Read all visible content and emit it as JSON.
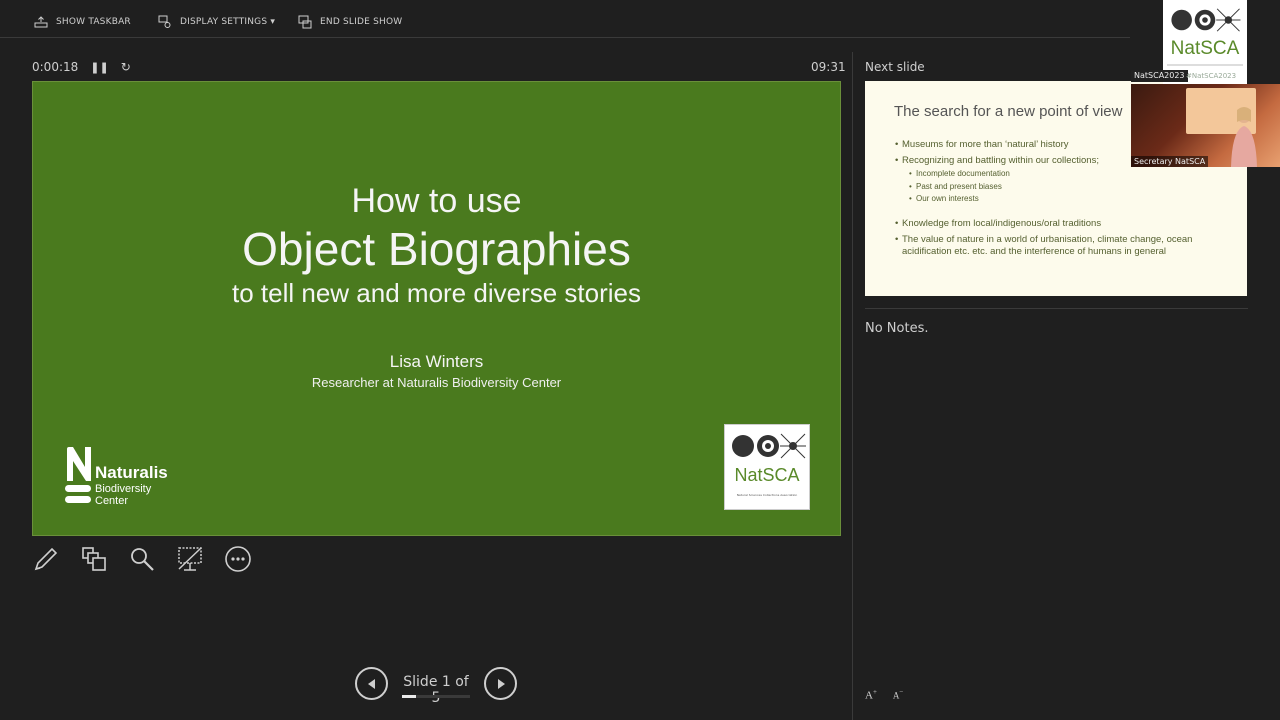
{
  "toolbar": {
    "show_taskbar": "SHOW TASKBAR",
    "display_settings": "DISPLAY SETTINGS ▾",
    "end_slide_show": "END SLIDE SHOW"
  },
  "timer": {
    "elapsed": "0:00:18",
    "clock": "09:31"
  },
  "current_slide": {
    "line1": "How to use",
    "line2": "Object Biographies",
    "line3": "to tell new and more diverse stories",
    "author": "Lisa Winters",
    "role": "Researcher at Naturalis Biodiversity Center",
    "naturalis_logo": {
      "title": "Naturalis",
      "sub1": "Biodiversity",
      "sub2": "Center"
    },
    "natsca_logo": {
      "word": "NatSCA",
      "tagline": "Natural Sciences Collections Association"
    },
    "background_color": "#4a7a1e"
  },
  "tools": [
    "pen-icon",
    "slides-grid-icon",
    "zoom-icon",
    "black-screen-icon",
    "more-options-icon"
  ],
  "navigation": {
    "slide_count": "Slide 1 of 5",
    "progress": 0.2
  },
  "next_slide": {
    "label": "Next slide",
    "title": "The search for a new point of view",
    "bullets": [
      {
        "level": 1,
        "text": "Museums for more than ‘natural’ history"
      },
      {
        "level": 1,
        "text": "Recognizing and battling within our collections;"
      },
      {
        "level": 2,
        "text": "Incomplete documentation"
      },
      {
        "level": 2,
        "text": "Past and present biases"
      },
      {
        "level": 2,
        "text": "Our own interests"
      },
      {
        "level": 1,
        "text": "Knowledge from local/indigenous/oral traditions"
      },
      {
        "level": 1,
        "text": "The value of nature in a world of urbanisation, climate change, ocean acidification etc. etc. and the interference of humans in general"
      }
    ]
  },
  "notes": {
    "text": "No Notes."
  },
  "font_controls": {
    "increase": "A",
    "decrease": "A"
  },
  "overlay": {
    "logo_word": "NatSCA",
    "cam_label": "NatSCA2023",
    "cam_hashtag": "#NatSCA2023",
    "cam_name": "Secretary NatSCA"
  }
}
